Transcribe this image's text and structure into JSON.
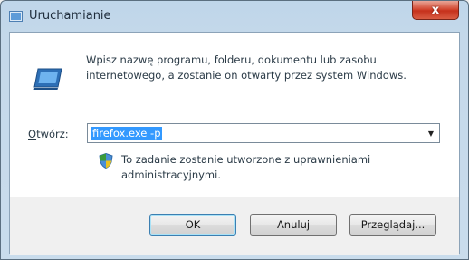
{
  "window": {
    "title": "Uruchamianie",
    "close_label": "x"
  },
  "dialog": {
    "description": "Wpisz nazwę programu, folderu, dokumentu lub zasobu internetowego, a zostanie on otwarty przez system Windows.",
    "open_label_accel": "O",
    "open_label_rest": "twórz:",
    "open_value": "firefox.exe -p",
    "admin_note": "To zadanie zostanie utworzone z uprawnieniami administracyjnymi."
  },
  "buttons": {
    "ok": "OK",
    "cancel": "Anuluj",
    "browse": "Przeglądaj..."
  },
  "icons": {
    "title": "run-icon",
    "main": "run-icon",
    "admin": "shield-icon",
    "dropdown": "chevron-down-icon"
  },
  "colors": {
    "selection": "#3399ff",
    "close": "#c6311c",
    "frame": "#c4d8ea"
  }
}
